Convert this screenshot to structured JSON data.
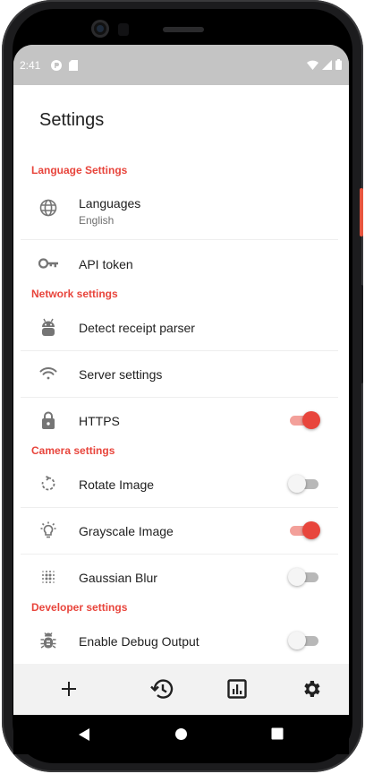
{
  "status_bar": {
    "time": "2:41"
  },
  "page": {
    "title": "Settings"
  },
  "sections": {
    "language": "Language Settings",
    "network": "Network settings",
    "camera": "Camera settings",
    "developer": "Developer settings"
  },
  "items": {
    "languages": {
      "label": "Languages",
      "value": "English",
      "icon": "globe-icon"
    },
    "api_token": {
      "label": "API token",
      "icon": "key-icon"
    },
    "detect_parser": {
      "label": "Detect receipt parser",
      "icon": "android-icon"
    },
    "server_settings": {
      "label": "Server settings",
      "icon": "wifi-icon"
    },
    "https": {
      "label": "HTTPS",
      "icon": "lock-icon",
      "enabled": true
    },
    "rotate_image": {
      "label": "Rotate Image",
      "icon": "rotate-icon",
      "enabled": false
    },
    "grayscale_image": {
      "label": "Grayscale Image",
      "icon": "bulb-icon",
      "enabled": true
    },
    "gaussian_blur": {
      "label": "Gaussian Blur",
      "icon": "blur-icon",
      "enabled": false
    },
    "debug_output": {
      "label": "Enable Debug Output",
      "icon": "bug-icon",
      "enabled": false
    }
  },
  "bottom_nav": [
    "add-icon",
    "history-icon",
    "stats-icon",
    "settings-icon"
  ],
  "colors": {
    "accent": "#e8453c",
    "status_bar": "#c4c4c4",
    "nav_bg": "#f2f2f2"
  }
}
